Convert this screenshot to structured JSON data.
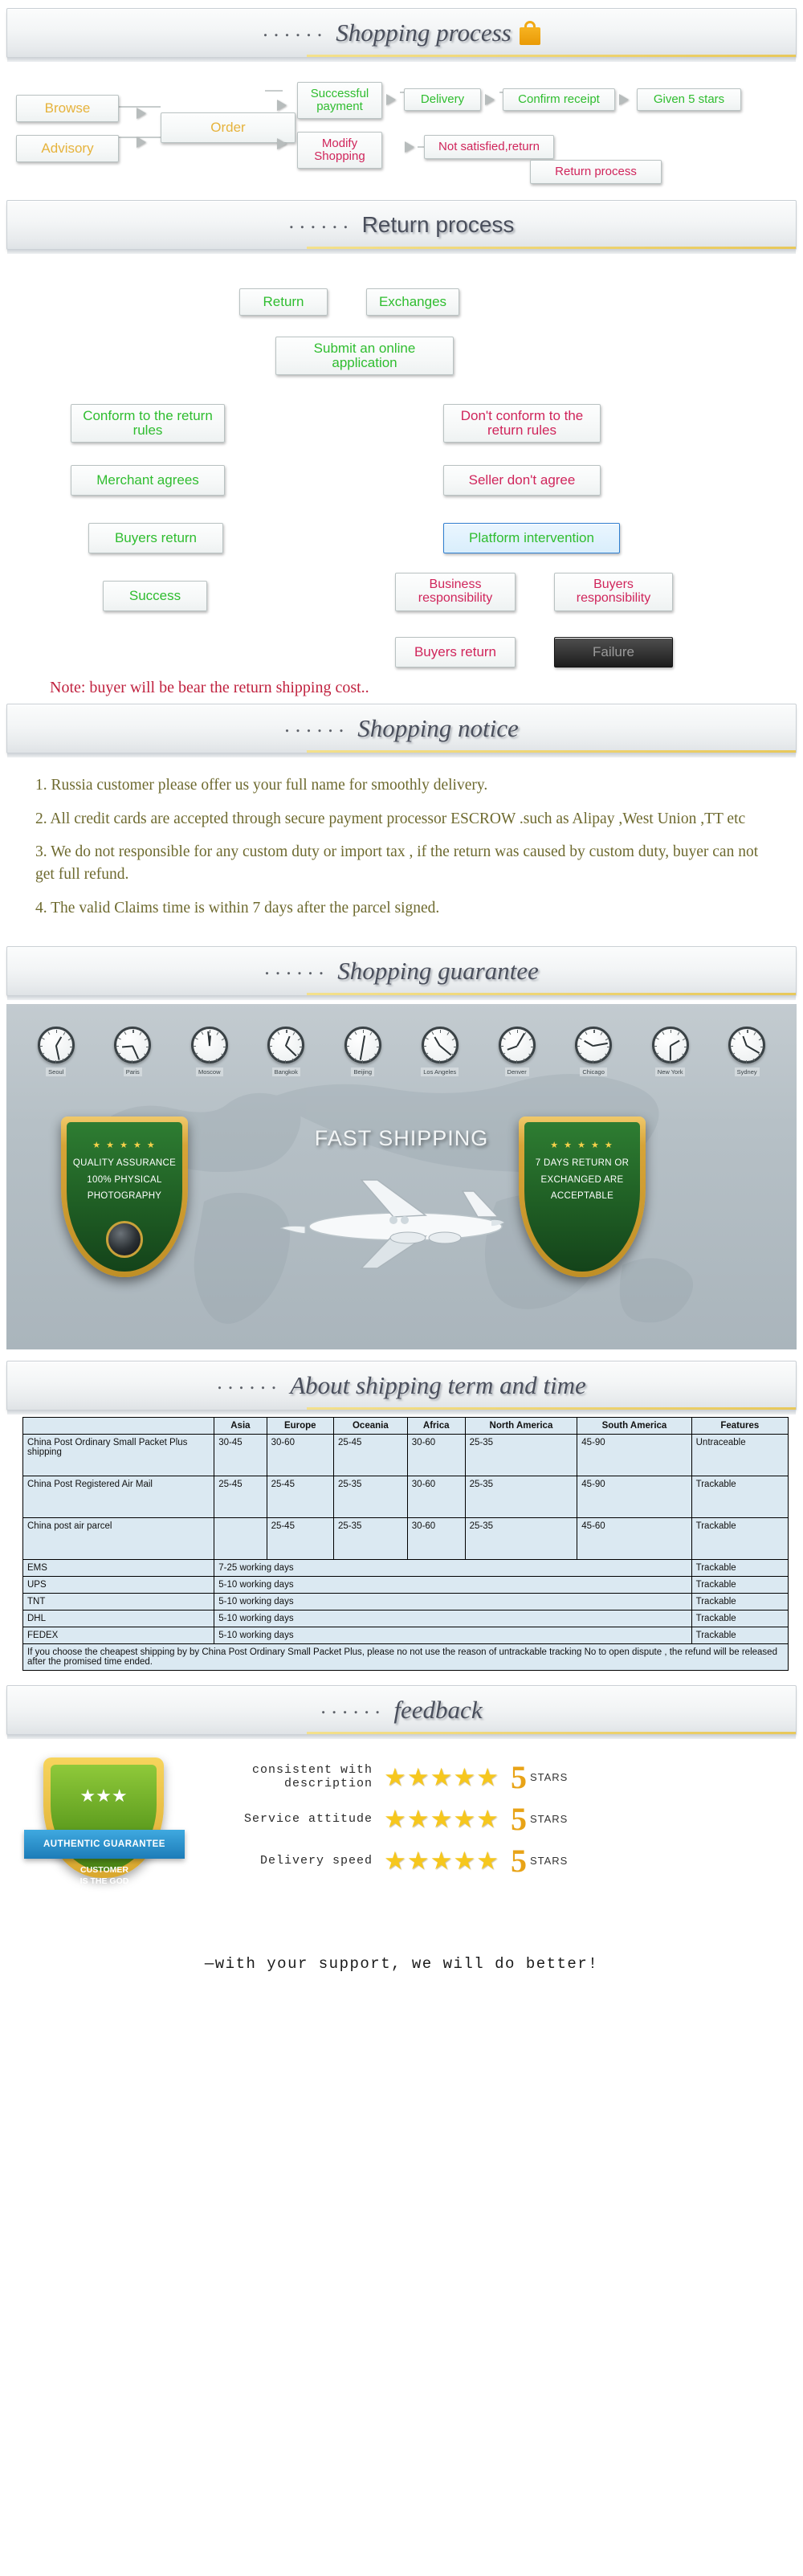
{
  "sections": {
    "shopping_process": {
      "dots": "......",
      "title": "Shopping process",
      "icon": "shopping-bag-icon"
    },
    "return_process": {
      "dots": "......",
      "title": "Return process"
    },
    "shopping_notice": {
      "dots": "......",
      "title": "Shopping notice"
    },
    "shopping_guarantee": {
      "dots": "......",
      "title": "Shopping guarantee"
    },
    "shipping_term": {
      "dots": "......",
      "title": "About shipping term and time"
    },
    "feedback": {
      "dots": "......",
      "title": "feedback"
    }
  },
  "shopping_flow": {
    "browse": "Browse",
    "advisory": "Advisory",
    "order": "Order",
    "successful_payment": "Successful payment",
    "modify_shopping": "Modify Shopping",
    "delivery": "Delivery",
    "confirm_receipt": "Confirm receipt",
    "given_5_stars": "Given 5 stars",
    "not_satisfied_return": "Not satisfied,return",
    "return_process": "Return process"
  },
  "return_flow": {
    "return": "Return",
    "exchanges": "Exchanges",
    "submit_online_application": "Submit an online application",
    "conform_rules": "Conform to the return rules",
    "not_conform_rules": "Don't conform to the return rules",
    "merchant_agrees": "Merchant agrees",
    "seller_dont_agree": "Seller don't agree",
    "buyers_return_left": "Buyers return",
    "platform_intervention": "Platform intervention",
    "success": "Success",
    "business_responsibility": "Business responsibility",
    "buyers_responsibility": "Buyers responsibility",
    "buyers_return_right": "Buyers return",
    "failure": "Failure",
    "note": "Note: buyer will be bear the return shipping cost.."
  },
  "notice_lines": [
    "1. Russia customer please offer us your full name for smoothly delivery.",
    "2. All credit cards are accepted through secure payment processor ESCROW .such as Alipay ,West Union ,TT etc",
    "3. We do not responsible for any custom duty or import tax , if the return was caused by custom duty,  buyer can not get full refund.",
    "4. The valid Claims time is within 7 days after the parcel signed."
  ],
  "guarantee": {
    "clocks": [
      {
        "city": "Seoul",
        "hour": 0,
        "minute": 2
      },
      {
        "city": "Paris",
        "hour": 8,
        "minute": 52
      },
      {
        "city": "Moscow",
        "hour": 11,
        "minute": 59
      },
      {
        "city": "Bangkok",
        "hour": 4,
        "minute": 52
      },
      {
        "city": "Beijing",
        "hour": 6,
        "minute": 0
      },
      {
        "city": "Los Angeles",
        "hour": 1,
        "minute": 52
      },
      {
        "city": "Denver",
        "hour": 9,
        "minute": 5
      },
      {
        "city": "Chicago",
        "hour": 10,
        "minute": 10
      },
      {
        "city": "New York",
        "hour": 2,
        "minute": 30
      },
      {
        "city": "Sydney",
        "hour": 7,
        "minute": 20
      }
    ],
    "left_shield": {
      "stars": "★ ★ ★ ★ ★",
      "line1": "QUALITY ASSURANCE",
      "line2": "100%  PHYSICAL",
      "line3": "PHOTOGRAPHY",
      "icon": "camera-icon"
    },
    "right_shield": {
      "stars": "★ ★ ★ ★ ★",
      "line1": "7 DAYS RETURN OR",
      "line2": "EXCHANGED ARE",
      "line3": "ACCEPTABLE"
    },
    "center_text": "FAST SHIPPING"
  },
  "shipping_table": {
    "headers": [
      "",
      "Asia",
      "Europe",
      "Oceania",
      "Africa",
      "North America",
      "South America",
      "Features"
    ],
    "rows": [
      {
        "name": "China Post Ordinary Small Packet Plus shipping",
        "cells": [
          "30-45",
          "30-60",
          "25-45",
          "30-60",
          "25-35",
          "45-90",
          "Untraceable"
        ],
        "tall": true
      },
      {
        "name": "China Post Registered Air Mail",
        "cells": [
          "25-45",
          "25-45",
          "25-35",
          "30-60",
          "25-35",
          "45-90",
          "Trackable"
        ],
        "tall": true
      },
      {
        "name": "China  post  air parcel",
        "cells": [
          "",
          "25-45",
          "25-35",
          "30-60",
          "25-35",
          "45-60",
          "Trackable"
        ],
        "tall": true
      },
      {
        "name": "EMS",
        "span": "7-25 working days",
        "feature": "Trackable"
      },
      {
        "name": "UPS",
        "span": "5-10 working days",
        "feature": "Trackable"
      },
      {
        "name": "TNT",
        "span": "5-10 working days",
        "feature": "Trackable"
      },
      {
        "name": "DHL",
        "span": "5-10 working days",
        "feature": "Trackable"
      },
      {
        "name": "FEDEX",
        "span": "5-10 working days",
        "feature": "Trackable"
      }
    ],
    "footer_note": "If you choose the cheapest shipping by by China Post Ordinary Small Packet Plus, please no not use the reason of untrackable tracking No to open dispute , the refund will be released after the promised time ended."
  },
  "feedback": {
    "badge": {
      "ribbon": "AUTHENTIC GUARANTEE",
      "sub_line1": "CUSTOMER",
      "sub_line2": "IS THE GOD",
      "stars": "★★★"
    },
    "rows": [
      {
        "label": "consistent with description",
        "stars": "★★★★★",
        "score": "5",
        "unit": "STARS"
      },
      {
        "label": "Service attitude",
        "stars": "★★★★★",
        "score": "5",
        "unit": "STARS"
      },
      {
        "label": "Delivery speed",
        "stars": "★★★★★",
        "score": "5",
        "unit": "STARS"
      }
    ],
    "footer": "—with your support, we will do better!"
  }
}
